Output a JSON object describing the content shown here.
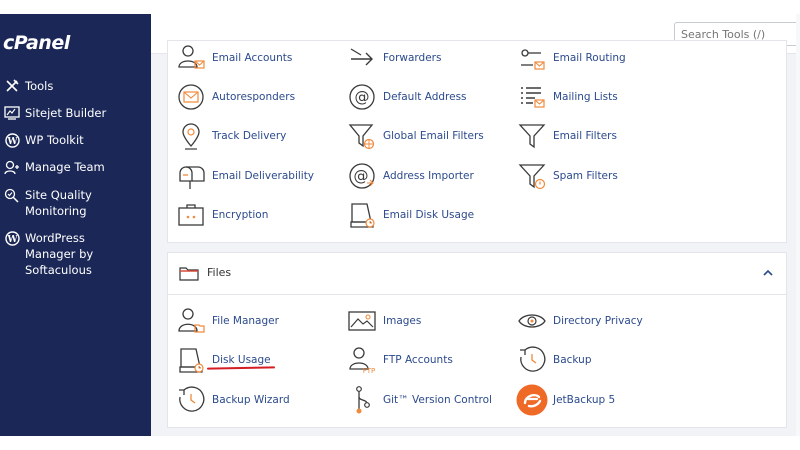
{
  "sidebar": {
    "logo": "cPanel",
    "items": [
      {
        "label": "Tools",
        "icon": "tools-icon"
      },
      {
        "label": "Sitejet Builder",
        "icon": "sitejet-icon"
      },
      {
        "label": "WP Toolkit",
        "icon": "wordpress-icon"
      },
      {
        "label": "Manage Team",
        "icon": "manage-team-icon"
      },
      {
        "label": "Site Quality\nMonitoring",
        "icon": "site-quality-icon"
      },
      {
        "label": "WordPress\nManager by\nSoftaculous",
        "icon": "wordpress-icon"
      }
    ]
  },
  "search": {
    "placeholder": "Search Tools (/)"
  },
  "email_section": {
    "tools": [
      {
        "label": "Email Accounts",
        "icon": "email-accounts-icon"
      },
      {
        "label": "Forwarders",
        "icon": "forwarders-icon"
      },
      {
        "label": "Email Routing",
        "icon": "email-routing-icon"
      },
      {
        "label": "Autoresponders",
        "icon": "autoresponders-icon"
      },
      {
        "label": "Default Address",
        "icon": "at-sign-icon"
      },
      {
        "label": "Mailing Lists",
        "icon": "mailing-lists-icon"
      },
      {
        "label": "Track Delivery",
        "icon": "track-delivery-icon"
      },
      {
        "label": "Global Email Filters",
        "icon": "global-filter-icon"
      },
      {
        "label": "Email Filters",
        "icon": "filter-icon"
      },
      {
        "label": "Email Deliverability",
        "icon": "mailbox-icon"
      },
      {
        "label": "Address Importer",
        "icon": "address-importer-icon"
      },
      {
        "label": "Spam Filters",
        "icon": "spam-filter-icon"
      },
      {
        "label": "Encryption",
        "icon": "encryption-icon"
      },
      {
        "label": "Email Disk Usage",
        "icon": "email-disk-usage-icon"
      }
    ]
  },
  "files_section": {
    "title": "Files",
    "tools": [
      {
        "label": "File Manager",
        "icon": "file-manager-icon"
      },
      {
        "label": "Images",
        "icon": "images-icon"
      },
      {
        "label": "Directory Privacy",
        "icon": "eye-icon"
      },
      {
        "label": "Disk Usage",
        "icon": "disk-usage-icon"
      },
      {
        "label": "FTP Accounts",
        "icon": "ftp-accounts-icon"
      },
      {
        "label": "Backup",
        "icon": "backup-icon"
      },
      {
        "label": "Backup Wizard",
        "icon": "backup-wizard-icon"
      },
      {
        "label": "Git™ Version Control",
        "icon": "git-icon"
      },
      {
        "label": "JetBackup 5",
        "icon": "jetbackup-icon"
      }
    ]
  },
  "colors": {
    "sidebar_bg": "#1b2857",
    "link": "#2b4a8c",
    "icon_stroke": "#3a3a3a",
    "icon_accent": "#f08a3c",
    "annotation": "#d41d24",
    "jetbackup": "#ef6a27"
  }
}
